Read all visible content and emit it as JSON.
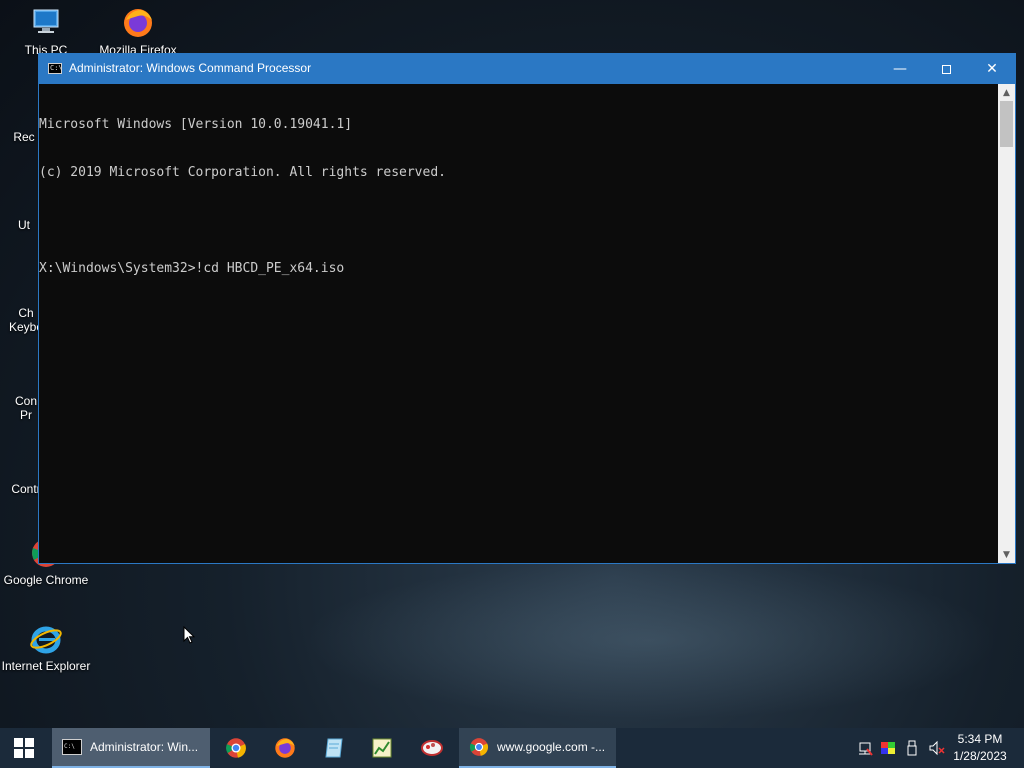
{
  "desktop": {
    "icons": [
      {
        "label": "This PC"
      },
      {
        "label": "Mozilla Firefox"
      },
      {
        "label": "Rec"
      },
      {
        "label": "Ut"
      },
      {
        "label": "Ch"
      },
      {
        "label": "Keybo"
      },
      {
        "label": "Con"
      },
      {
        "label": "Pr"
      },
      {
        "label": "Contr"
      },
      {
        "label": "Google Chrome"
      },
      {
        "label": "Internet Explorer"
      }
    ]
  },
  "window": {
    "title": "Administrator: Windows Command Processor",
    "icon": "cmd-icon",
    "console_lines": [
      "Microsoft Windows [Version 10.0.19041.1]",
      "(c) 2019 Microsoft Corporation. All rights reserved.",
      "",
      "X:\\Windows\\System32>!cd HBCD_PE_x64.iso"
    ]
  },
  "taskbar": {
    "start_icon": "windows-logo-icon",
    "cmd_task_label": "Administrator: Win...",
    "chrome_task_label": "www.google.com -...",
    "pinned": [
      "chrome-icon",
      "firefox-icon",
      "notepad-icon",
      "spreadsheet-icon",
      "paint-icon"
    ],
    "tray": [
      "network-icon",
      "color-icon",
      "usb-icon",
      "volume-muted-icon"
    ],
    "time": "5:34 PM",
    "date": "1/28/2023"
  },
  "colors": {
    "title_bar": "#2b78c4",
    "console_bg": "#0c0c0c",
    "console_text": "#cccccc",
    "taskbar": "#1b2a3a"
  }
}
